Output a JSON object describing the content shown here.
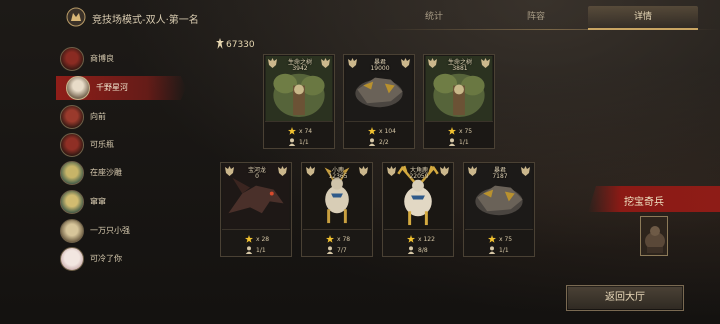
{
  "header": {
    "mode_title": "竞技场模式-双人·第一名",
    "tabs": [
      {
        "label": "统计",
        "active": false
      },
      {
        "label": "阵容",
        "active": false
      },
      {
        "label": "详情",
        "active": true
      }
    ]
  },
  "players": [
    {
      "name": "商博良",
      "selected": false
    },
    {
      "name": "千野星河",
      "selected": true
    },
    {
      "name": "向前",
      "selected": false
    },
    {
      "name": "可乐瓶",
      "selected": false
    },
    {
      "name": "在座沙雕",
      "selected": false
    },
    {
      "name": "窜窜",
      "selected": false
    },
    {
      "name": "一万只小强",
      "selected": false
    },
    {
      "name": "可冷了你",
      "selected": false
    }
  ],
  "lineup": {
    "total_power": "67330",
    "row1": [
      {
        "name": "生命之树",
        "power": "3942",
        "stars": "x 74",
        "count": "1/1",
        "art": "treant"
      },
      {
        "name": "暴君",
        "power": "19000",
        "stars": "x 104",
        "count": "2/2",
        "art": "tyrant"
      },
      {
        "name": "生命之树",
        "power": "3881",
        "stars": "x 75",
        "count": "1/1",
        "art": "treant"
      }
    ],
    "row2": [
      {
        "name": "宝河龙",
        "power": "0",
        "stars": "x 28",
        "count": "1/1",
        "art": "dragon"
      },
      {
        "name": "小鹿",
        "power": "12365",
        "stars": "x 78",
        "count": "7/7",
        "art": "deer"
      },
      {
        "name": "大角鹿",
        "power": "22059",
        "stars": "x 122",
        "count": "8/8",
        "art": "elk"
      },
      {
        "name": "暴君",
        "power": "7187",
        "stars": "x 75",
        "count": "1/1",
        "art": "tyrant"
      }
    ]
  },
  "special": {
    "label": "挖宝奇兵"
  },
  "actions": {
    "return_label": "返回大厅"
  },
  "colors": {
    "accent_red": "#8e1c17",
    "gold": "#c9a563",
    "star": "#f2c230"
  }
}
